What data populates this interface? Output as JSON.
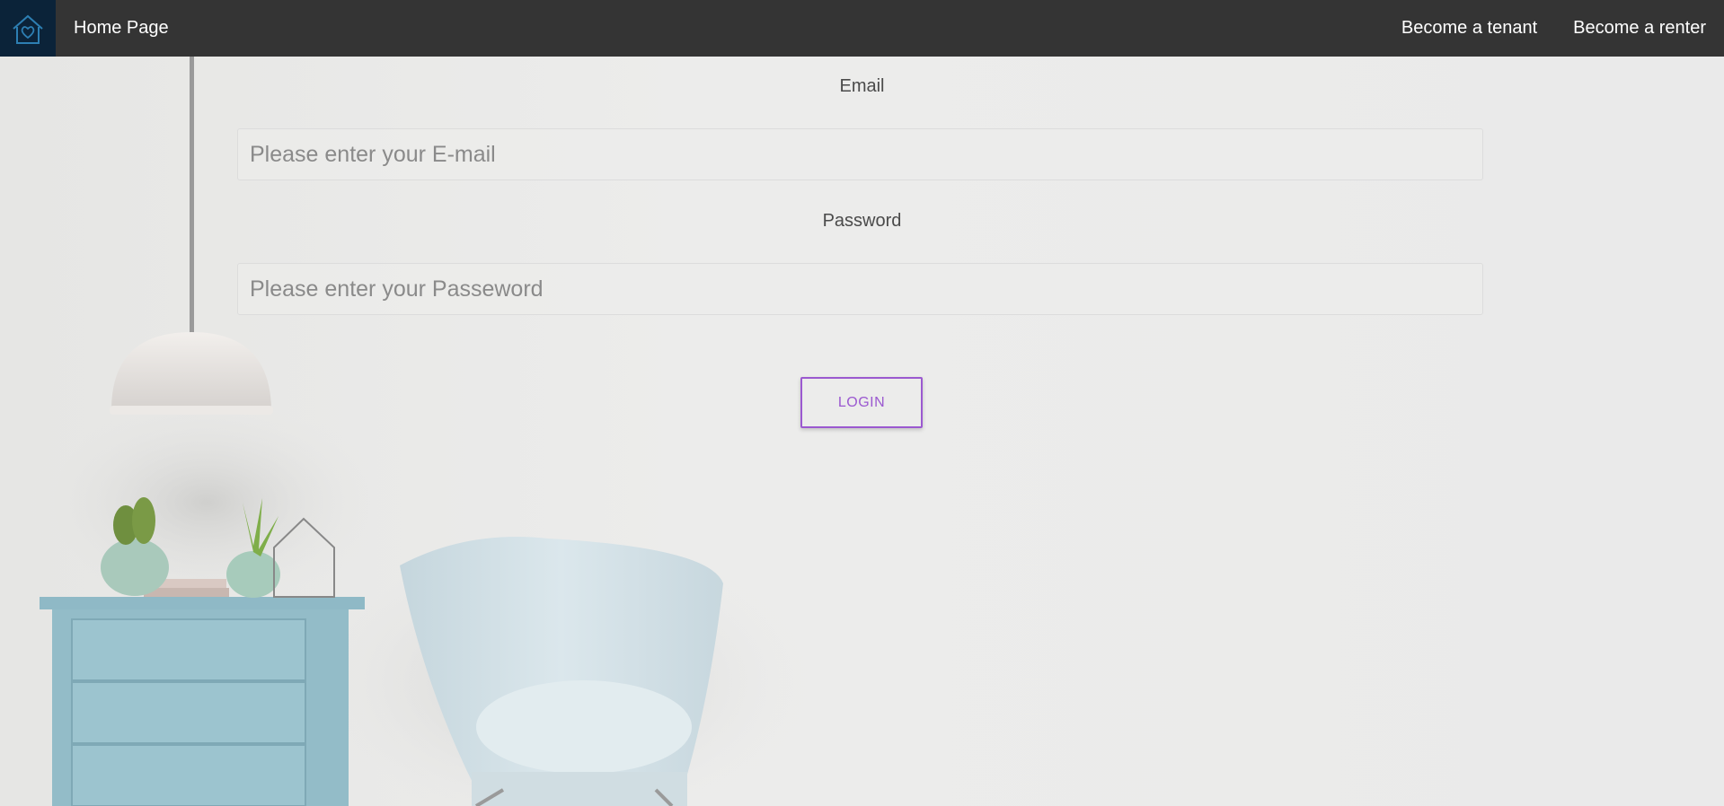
{
  "nav": {
    "brand": "Home Page",
    "links": [
      "Become a tenant",
      "Become a renter"
    ]
  },
  "form": {
    "email_label": "Email",
    "email_placeholder": "Please enter your E-mail",
    "password_label": "Password",
    "password_placeholder": "Please enter your Passeword",
    "login_label": "LOGIN"
  },
  "colors": {
    "navbar": "#343434",
    "logo_bg": "#0b2339",
    "accent": "#9b59d0"
  },
  "icons": [
    "house-heart-logo-icon"
  ]
}
